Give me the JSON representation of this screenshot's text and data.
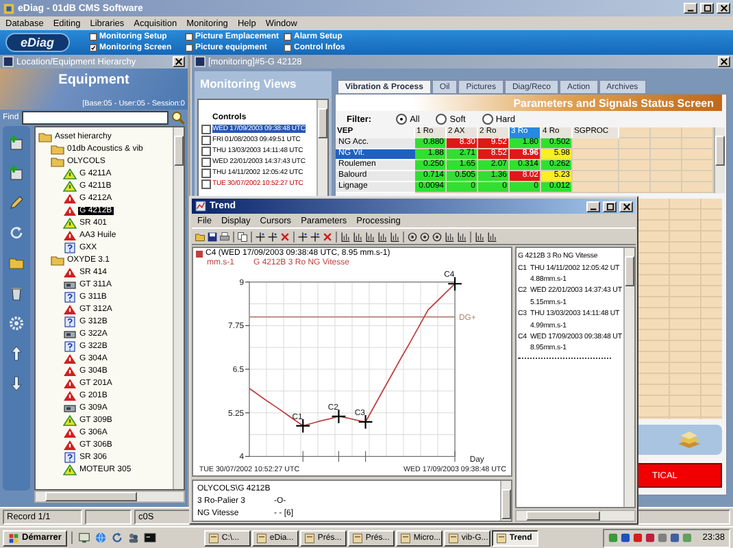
{
  "window": {
    "title": "eDiag - 01dB CMS Software"
  },
  "menu": [
    "Database",
    "Editing",
    "Libraries",
    "Acquisition",
    "Monitoring",
    "Help",
    "Window"
  ],
  "banner": {
    "logo": "eDiag",
    "options": [
      {
        "label": "Monitoring Setup",
        "checked": false
      },
      {
        "label": "Monitoring Screen",
        "checked": true
      },
      {
        "label": "Picture Emplacement",
        "checked": false
      },
      {
        "label": "Picture equipment",
        "checked": false
      },
      {
        "label": "Alarm Setup",
        "checked": false
      },
      {
        "label": "Control Infos",
        "checked": false
      }
    ]
  },
  "hierarchy": {
    "title": "Location/Equipment Hierarchy",
    "heading": "Equipment",
    "session": "[Base:05 - User:05 - Session:0",
    "find_label": "Find",
    "tree": [
      {
        "label": "Asset hierarchy",
        "kind": "folder",
        "selected": false,
        "children": [
          {
            "label": "01db Acoustics & vib",
            "kind": "folder",
            "selected": false
          },
          {
            "label": "OLYCOLS",
            "kind": "folder",
            "selected": false,
            "children": [
              {
                "label": "G 4211A",
                "kind": "warning",
                "selected": false
              },
              {
                "label": "G 4211B",
                "kind": "warning",
                "selected": false
              },
              {
                "label": "G 4212A",
                "kind": "alarm",
                "selected": false
              },
              {
                "label": "G 4212B",
                "kind": "alarm",
                "selected": true
              },
              {
                "label": "SR 401",
                "kind": "warning",
                "selected": false
              },
              {
                "label": "AA3 Huile",
                "kind": "alarm",
                "selected": false
              },
              {
                "label": "GXX",
                "kind": "unknown",
                "selected": false
              }
            ]
          },
          {
            "label": "OXYDE 3.1",
            "kind": "folder",
            "selected": false,
            "children": [
              {
                "label": "SR 414",
                "kind": "alarm",
                "selected": false
              },
              {
                "label": "GT 311A",
                "kind": "machine",
                "selected": false
              },
              {
                "label": "G 311B",
                "kind": "unknown",
                "selected": false
              },
              {
                "label": "GT 312A",
                "kind": "alarm",
                "selected": false
              },
              {
                "label": "G 312B",
                "kind": "unknown",
                "selected": false
              },
              {
                "label": "G 322A",
                "kind": "machine",
                "selected": false
              },
              {
                "label": "G 322B",
                "kind": "unknown",
                "selected": false
              },
              {
                "label": "G 304A",
                "kind": "alarm",
                "selected": false
              },
              {
                "label": "G 304B",
                "kind": "alarm",
                "selected": false
              },
              {
                "label": "GT 201A",
                "kind": "alarm",
                "selected": false
              },
              {
                "label": "G 201B",
                "kind": "alarm",
                "selected": false
              },
              {
                "label": "G 309A",
                "kind": "machine",
                "selected": false
              },
              {
                "label": "GT 309B",
                "kind": "warning",
                "selected": false
              },
              {
                "label": "G 306A",
                "kind": "alarm",
                "selected": false
              },
              {
                "label": "GT 306B",
                "kind": "alarm",
                "selected": false
              },
              {
                "label": "SR 306",
                "kind": "unknown",
                "selected": false
              },
              {
                "label": "MOTEUR 305",
                "kind": "warning",
                "selected": false
              }
            ]
          }
        ]
      }
    ]
  },
  "monitoring": {
    "title": "[monitoring]#5-G 42128",
    "views_heading": "Monitoring Views",
    "controls_label": "Controls",
    "controls": [
      {
        "date": "WED 17/09/2003 09:38:48 UTC",
        "kind": "normal",
        "checked": false,
        "selected": true
      },
      {
        "date": "FRI 01/08/2003 09:49:51 UTC",
        "kind": "normal",
        "checked": false,
        "selected": false
      },
      {
        "date": "THU 13/03/2003 14:11:48 UTC",
        "kind": "normal",
        "checked": false,
        "selected": false
      },
      {
        "date": "WED 22/01/2003 14:37:43 UTC",
        "kind": "normal",
        "checked": false,
        "selected": false
      },
      {
        "date": "THU 14/11/2002 12:05:42 UTC",
        "kind": "normal",
        "checked": false,
        "selected": false
      },
      {
        "date": "TUE 30/07/2002 10:52:27 UTC",
        "kind": "reference",
        "checked": false,
        "selected": false
      }
    ],
    "tabs": [
      {
        "label": "Vibration & Process",
        "selected": true
      },
      {
        "label": "Oil",
        "selected": false
      },
      {
        "label": "Pictures",
        "selected": false
      },
      {
        "label": "Diag/Reco",
        "selected": false
      },
      {
        "label": "Action",
        "selected": false
      },
      {
        "label": "Archives",
        "selected": false
      }
    ],
    "status_heading": "Parameters and Signals Status Screen",
    "filter": {
      "label": "Filter:",
      "options": [
        {
          "label": "All",
          "selected": true
        },
        {
          "label": "Soft",
          "selected": false
        },
        {
          "label": "Hard",
          "selected": false
        }
      ]
    },
    "table": {
      "group": "VEP",
      "columns": [
        {
          "label": "1 Ro",
          "selected": false
        },
        {
          "label": "2 AX",
          "selected": false
        },
        {
          "label": "2 Ro",
          "selected": false
        },
        {
          "label": "3 Ro",
          "selected": true
        },
        {
          "label": "4 Ro",
          "selected": false
        },
        {
          "label": "SGPROC",
          "selected": false
        }
      ],
      "rows": [
        {
          "label": "NG Acc.",
          "selected": false,
          "cells": [
            {
              "value": "0.880",
              "color": "#30e030"
            },
            {
              "value": "8.30",
              "color": "#e01818"
            },
            {
              "value": "9.52",
              "color": "#e01818"
            },
            {
              "value": "1.80",
              "color": "#30e030"
            },
            {
              "value": "0.502",
              "color": "#30e030"
            }
          ]
        },
        {
          "label": "NG Vit.",
          "selected": true,
          "cells": [
            {
              "value": "1.88",
              "color": "#30e030"
            },
            {
              "value": "2.71",
              "color": "#30e030"
            },
            {
              "value": "8.52",
              "color": "#e01818"
            },
            {
              "value": "8.96",
              "color": "#e01818"
            },
            {
              "value": "5.98",
              "color": "#f8f020"
            }
          ]
        },
        {
          "label": "Roulemen",
          "selected": false,
          "cells": [
            {
              "value": "0.250",
              "color": "#30e030"
            },
            {
              "value": "1.65",
              "color": "#30e030"
            },
            {
              "value": "2.07",
              "color": "#30e030"
            },
            {
              "value": "0.314",
              "color": "#30e030"
            },
            {
              "value": "0.262",
              "color": "#30e030"
            }
          ]
        },
        {
          "label": "Balourd",
          "selected": false,
          "cells": [
            {
              "value": "0.714",
              "color": "#30e030"
            },
            {
              "value": "0.505",
              "color": "#30e030"
            },
            {
              "value": "1.36",
              "color": "#30e030"
            },
            {
              "value": "8.02",
              "color": "#e01818"
            },
            {
              "value": "5.23",
              "color": "#f8f020"
            }
          ]
        },
        {
          "label": "Lignage",
          "selected": false,
          "cells": [
            {
              "value": "0.0094",
              "color": "#30e030"
            },
            {
              "value": "0",
              "color": "#30e030"
            },
            {
              "value": "0",
              "color": "#30e030"
            },
            {
              "value": "0",
              "color": "#30e030"
            },
            {
              "value": "0.012",
              "color": "#30e030"
            }
          ]
        }
      ]
    },
    "critical": "TICAL"
  },
  "trend": {
    "title": "Trend",
    "menu": [
      "File",
      "Display",
      "Cursors",
      "Parameters",
      "Processing"
    ],
    "legend": "C4 (WED 17/09/2003 09:38:48 UTC, 8.95 mm.s-1)",
    "unit": "mm.s-1",
    "chart_data": {
      "type": "line",
      "xlabel": "Day",
      "ylim": [
        4,
        9
      ],
      "grid": true,
      "categories": [
        "TUE 30/07/2002 10:52:27 UTC",
        null,
        null,
        null,
        null,
        null,
        null,
        null,
        null,
        null,
        null,
        null,
        null,
        null,
        null,
        null,
        null,
        null,
        null,
        null,
        null,
        null,
        null,
        "WED 17/09/2003 09:38:48 UTC"
      ],
      "series": [
        {
          "name": "G 4212B 3 Ro NG Vitesse",
          "color": "#c04040",
          "values": [
            5.95,
            5.77,
            5.59,
            5.42,
            5.24,
            5.06,
            4.88,
            4.95,
            5.02,
            5.08,
            5.15,
            5.1,
            5.04,
            4.99,
            5.45,
            5.91,
            6.37,
            6.83,
            7.28,
            7.74,
            8.2,
            8.45,
            8.7,
            8.95
          ]
        },
        {
          "name": "DG+",
          "color": "#b08070",
          "values": [
            8,
            8,
            8,
            8,
            8,
            8,
            8,
            8,
            8,
            8,
            8,
            8,
            8,
            8,
            8,
            8,
            8,
            8,
            8,
            8,
            8,
            8,
            8,
            8
          ]
        }
      ],
      "yticks": [
        {
          "value": 4,
          "label": "4"
        },
        {
          "value": 5.25,
          "label": "5.25"
        },
        {
          "value": 6.5,
          "label": "6.5"
        },
        {
          "value": 7.75,
          "label": "7.75"
        },
        {
          "value": 9,
          "label": "9"
        }
      ],
      "annotations": [
        {
          "y": 4.88,
          "text": "C1"
        },
        {
          "y": 5.15,
          "text": "C2"
        },
        {
          "y": 4.99,
          "text": "C3"
        },
        {
          "y": 8.95,
          "text": "C4"
        }
      ]
    },
    "info": [
      {
        "name": "OLYCOLS\\G 4212B"
      },
      {
        "name": "3 Ro-Palier 3",
        "value": "-O-"
      },
      {
        "name": "NG Vitesse",
        "value": "- - [6]"
      }
    ],
    "cursor_list": {
      "title": "G 4212B 3 Ro NG Vitesse",
      "items": [
        {
          "label": "C1",
          "date": "THU 14/11/2002 12:05:42 UT",
          "value": "4.88mm.s-1"
        },
        {
          "label": "C2",
          "date": "WED 22/01/2003 14:37:43 UT",
          "value": "5.15mm.s-1"
        },
        {
          "label": "C3",
          "date": "THU 13/03/2003 14:11:48 UT",
          "value": "4.99mm.s-1"
        },
        {
          "label": "C4",
          "date": "WED 17/09/2003 09:38:48 UT",
          "value": "8.95mm.s-1"
        }
      ]
    }
  },
  "status_bar": {
    "record": "Record 1/1",
    "message": "c0S"
  },
  "taskbar": {
    "start": "Démarrer",
    "tasks": [
      {
        "label": "C:\\...",
        "selected": false
      },
      {
        "label": "eDia...",
        "selected": false
      },
      {
        "label": "Prés...",
        "selected": false
      },
      {
        "label": "Prés...",
        "selected": false
      },
      {
        "label": "Micro...",
        "selected": false
      },
      {
        "label": "vib-G...",
        "selected": false
      },
      {
        "label": "Trend",
        "selected": true
      }
    ],
    "clock": "23:38"
  }
}
